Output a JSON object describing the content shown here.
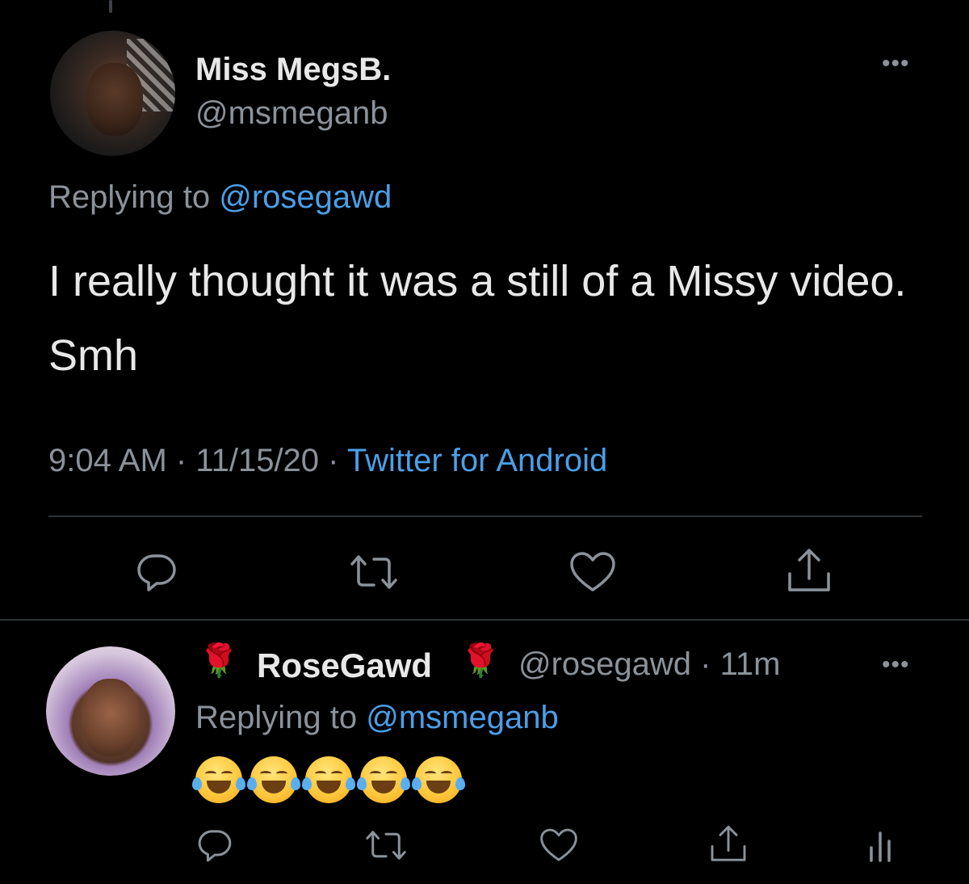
{
  "main_tweet": {
    "display_name": "Miss MegsB.",
    "handle": "@msmeganb",
    "more_label": "•••",
    "replying_prefix": "Replying to ",
    "replying_to": "@rosegawd",
    "text": "I really thought it was a still of a Missy video. Smh",
    "time": "9:04 AM",
    "date": "11/15/20",
    "separator": " · ",
    "source": "Twitter for Android",
    "actions": [
      "reply-icon",
      "retweet-icon",
      "like-icon",
      "share-icon"
    ]
  },
  "reply_tweet": {
    "display_name": "RoseGawd",
    "name_emoji": "🌹",
    "handle_time": "@rosegawd · 11m",
    "more_label": "•••",
    "replying_prefix": "Replying to ",
    "replying_to": "@msmeganb",
    "emoji_content": "😂😂😂😂😂",
    "actions": [
      "reply-icon",
      "retweet-icon",
      "like-icon",
      "share-icon",
      "analytics-icon"
    ]
  },
  "colors": {
    "background": "#000000",
    "text": "#e8e8e8",
    "secondary": "#8b9299",
    "link": "#4a9fe8",
    "divider": "#2f3336"
  }
}
